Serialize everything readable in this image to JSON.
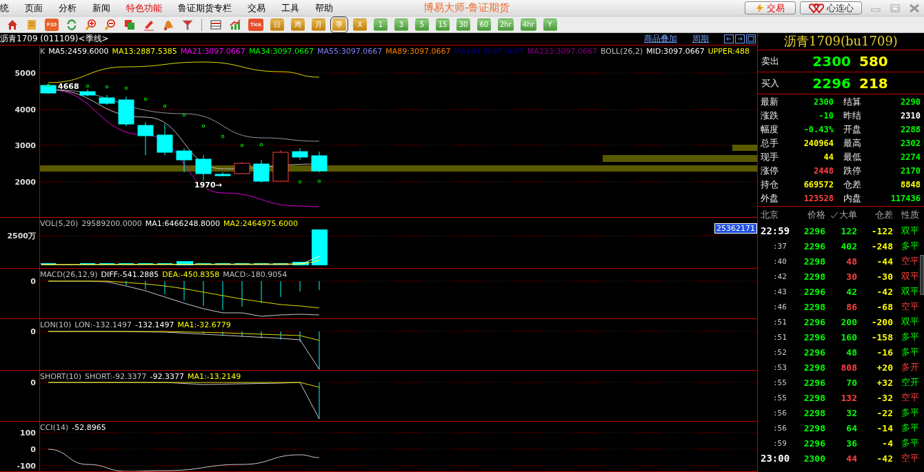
{
  "menu": {
    "items": [
      {
        "label": "统",
        "highlight": false
      },
      {
        "label": "页面",
        "highlight": false
      },
      {
        "label": "分析",
        "highlight": false
      },
      {
        "label": "新闻",
        "highlight": false
      },
      {
        "label": "特色功能",
        "highlight": true
      },
      {
        "label": "鲁证期货专栏",
        "highlight": false
      },
      {
        "label": "交易",
        "highlight": false
      },
      {
        "label": "工具",
        "highlight": false
      },
      {
        "label": "帮助",
        "highlight": false
      }
    ]
  },
  "app_title": "博易大师-鲁证期货",
  "top_buttons": [
    {
      "label": "交易",
      "kind": "trade"
    },
    {
      "label": "心连心",
      "kind": "hearts"
    }
  ],
  "toolbar": {
    "f10": "F10",
    "tick": "Tick",
    "periods": [
      {
        "label": "日",
        "kind": "gold",
        "selected": false
      },
      {
        "label": "周",
        "kind": "gold",
        "selected": false
      },
      {
        "label": "月",
        "kind": "gold",
        "selected": false
      },
      {
        "label": "季",
        "kind": "gold",
        "selected": true
      },
      {
        "label": "X",
        "kind": "gold",
        "selected": false
      },
      {
        "label": "1",
        "kind": "green",
        "selected": false
      },
      {
        "label": "3",
        "kind": "green",
        "selected": false
      },
      {
        "label": "5",
        "kind": "green",
        "selected": false
      },
      {
        "label": "15",
        "kind": "green",
        "selected": false
      },
      {
        "label": "30",
        "kind": "green",
        "selected": false
      },
      {
        "label": "60",
        "kind": "green",
        "selected": false
      },
      {
        "label": "2hr",
        "kind": "green",
        "selected": false
      },
      {
        "label": "4hr",
        "kind": "green",
        "selected": false
      },
      {
        "label": "Y",
        "kind": "green",
        "selected": false
      }
    ]
  },
  "chart_header": {
    "title": "沥青1709 (011109)<季线>",
    "links": [
      "商品叠加",
      "周期"
    ]
  },
  "main_panel": {
    "legend": [
      {
        "text": "K",
        "color": "#c0c0c0"
      },
      {
        "text": "MA5:2459.6000",
        "color": "#ffffff"
      },
      {
        "text": "MA13:2887.5385",
        "color": "#ffff00"
      },
      {
        "text": "MA21:3097.0667",
        "color": "#ff00ff"
      },
      {
        "text": "MA34:3097.0667",
        "color": "#00ff00"
      },
      {
        "text": "MA55:3097.0667",
        "color": "#8080ff"
      },
      {
        "text": "MA89:3097.0667",
        "color": "#ff8000"
      },
      {
        "text": "MA144:3097.0667",
        "color": "#000080"
      },
      {
        "text": "MA233:3097.0667",
        "color": "#800080"
      },
      {
        "text": "BOLL(26,2)",
        "color": "#c0c0c0"
      },
      {
        "text": "MID:3097.0667",
        "color": "#ffffff"
      },
      {
        "text": "UPPER:488",
        "color": "#ffff00"
      }
    ],
    "y_labels": [
      "5000",
      "4000",
      "3000",
      "2000"
    ],
    "annotations": [
      "4668",
      "1970→"
    ]
  },
  "indicator_panels": [
    {
      "kind": "volume",
      "legend": [
        {
          "text": "VOL(5,20)",
          "color": "#c0c0c0"
        },
        {
          "text": "29589200.0000",
          "color": "#c0c0c0"
        },
        {
          "text": "MA1:6466248.8000",
          "color": "#ffffff"
        },
        {
          "text": "MA2:2464975.6000",
          "color": "#ffff00"
        }
      ],
      "y_labels": [
        "2500万"
      ],
      "value_tag": "25362171"
    },
    {
      "kind": "macd",
      "legend": [
        {
          "text": "MACD(26,12,9)",
          "color": "#c0c0c0"
        },
        {
          "text": "DIFF:-541.2885",
          "color": "#ffffff"
        },
        {
          "text": "DEA:-450.8358",
          "color": "#ffff00"
        },
        {
          "text": "MACD:-180.9054",
          "color": "#c0c0c0"
        }
      ],
      "y_labels": [
        "0"
      ]
    },
    {
      "kind": "lon",
      "legend": [
        {
          "text": "LON(10)",
          "color": "#c0c0c0"
        },
        {
          "text": "LON:-132.1497",
          "color": "#c0c0c0"
        },
        {
          "text": "-132.1497",
          "color": "#ffffff"
        },
        {
          "text": "MA1:-32.6779",
          "color": "#ffff00"
        }
      ],
      "y_labels": [
        "0"
      ]
    },
    {
      "kind": "short",
      "legend": [
        {
          "text": "SHORT(10)",
          "color": "#c0c0c0"
        },
        {
          "text": "SHORT:-92.3377",
          "color": "#c0c0c0"
        },
        {
          "text": "-92.3377",
          "color": "#ffffff"
        },
        {
          "text": "MA1:-13.2149",
          "color": "#ffff00"
        }
      ],
      "y_labels": [
        "0"
      ]
    },
    {
      "kind": "cci",
      "legend": [
        {
          "text": "CCI(14)",
          "color": "#c0c0c0"
        },
        {
          "text": "-52.8965",
          "color": "#ffffff"
        }
      ],
      "y_labels": [
        "100",
        "0",
        "-100"
      ]
    }
  ],
  "quote": {
    "title": "沥青1709(bu1709)",
    "ask": {
      "label": "卖出",
      "price": "2300",
      "volume": "580"
    },
    "bid": {
      "label": "买入",
      "price": "2296",
      "volume": "218"
    },
    "stats": [
      {
        "label": "最新",
        "value": "2300",
        "color": "#00ff00"
      },
      {
        "label": "结算",
        "value": "2290",
        "color": "#00ff00"
      },
      {
        "label": "涨跌",
        "value": "-10",
        "color": "#00ff00"
      },
      {
        "label": "昨结",
        "value": "2310",
        "color": "#ffffff"
      },
      {
        "label": "幅度",
        "value": "-0.43%",
        "color": "#00ff00"
      },
      {
        "label": "开盘",
        "value": "2288",
        "color": "#00ff00"
      },
      {
        "label": "总手",
        "value": "240964",
        "color": "#ffff00"
      },
      {
        "label": "最高",
        "value": "2302",
        "color": "#00ff00"
      },
      {
        "label": "现手",
        "value": "44",
        "color": "#ffff00"
      },
      {
        "label": "最低",
        "value": "2274",
        "color": "#00ff00"
      },
      {
        "label": "涨停",
        "value": "2448",
        "color": "#ff4040"
      },
      {
        "label": "跌停",
        "value": "2170",
        "color": "#00ff00"
      },
      {
        "label": "持仓",
        "value": "669572",
        "color": "#ffff00"
      },
      {
        "label": "仓差",
        "value": "8848",
        "color": "#ffff00"
      },
      {
        "label": "外盘",
        "value": "123528",
        "color": "#ff4040"
      },
      {
        "label": "内盘",
        "value": "117436",
        "color": "#00ff00"
      }
    ]
  },
  "trades": {
    "columns": [
      "北京",
      "价格",
      "大单",
      "仓差",
      "性质"
    ],
    "rows": [
      {
        "time": "22:59",
        "kind": "full",
        "price": "2296",
        "volume": "122",
        "change": "-122",
        "nature": "双平",
        "color": "#00ff00"
      },
      {
        "time": ":37",
        "kind": "minute",
        "price": "2296",
        "volume": "402",
        "change": "-248",
        "nature": "多平",
        "color": "#00ff00"
      },
      {
        "time": ":40",
        "kind": "minute",
        "price": "2298",
        "volume": "48",
        "change": "-44",
        "nature": "空平",
        "color": "#ff4040"
      },
      {
        "time": ":42",
        "kind": "minute",
        "price": "2298",
        "volume": "30",
        "change": "-30",
        "nature": "双平",
        "color": "#ff4040"
      },
      {
        "time": ":43",
        "kind": "minute",
        "price": "2296",
        "volume": "42",
        "change": "-42",
        "nature": "双平",
        "color": "#00ff00"
      },
      {
        "time": ":46",
        "kind": "minute",
        "price": "2298",
        "volume": "86",
        "change": "-68",
        "nature": "空平",
        "color": "#ff4040"
      },
      {
        "time": ":51",
        "kind": "minute",
        "price": "2296",
        "volume": "200",
        "change": "-200",
        "nature": "双平",
        "color": "#00ff00"
      },
      {
        "time": ":51",
        "kind": "minute",
        "price": "2296",
        "volume": "160",
        "change": "-158",
        "nature": "多平",
        "color": "#00ff00"
      },
      {
        "time": ":52",
        "kind": "minute",
        "price": "2296",
        "volume": "48",
        "change": "-16",
        "nature": "多平",
        "color": "#00ff00"
      },
      {
        "time": ":53",
        "kind": "minute",
        "price": "2298",
        "volume": "808",
        "change": "+20",
        "nature": "多开",
        "color": "#ff4040"
      },
      {
        "time": ":55",
        "kind": "minute",
        "price": "2296",
        "volume": "70",
        "change": "+32",
        "nature": "空开",
        "color": "#00ff00"
      },
      {
        "time": ":55",
        "kind": "minute",
        "price": "2298",
        "volume": "132",
        "change": "-32",
        "nature": "空平",
        "color": "#ff4040"
      },
      {
        "time": ":56",
        "kind": "minute",
        "price": "2298",
        "volume": "32",
        "change": "-22",
        "nature": "多平",
        "color": "#00ff00"
      },
      {
        "time": ":56",
        "kind": "minute",
        "price": "2298",
        "volume": "64",
        "change": "-14",
        "nature": "多平",
        "color": "#00ff00"
      },
      {
        "time": ":59",
        "kind": "minute",
        "price": "2296",
        "volume": "36",
        "change": "-4",
        "nature": "多平",
        "color": "#00ff00"
      },
      {
        "time": "23:00",
        "kind": "full",
        "price": "2300",
        "volume": "44",
        "change": "-42",
        "nature": "空平",
        "color": "#ff4040"
      }
    ]
  }
}
